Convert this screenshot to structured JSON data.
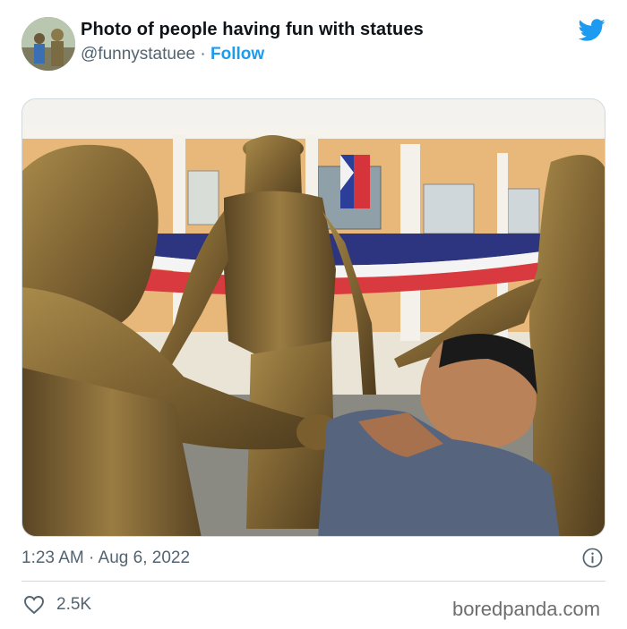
{
  "tweet": {
    "display_name": "Photo of people having fun with statues",
    "handle": "@funnystatuee",
    "separator": " · ",
    "follow_label": "Follow",
    "timestamp": "1:23 AM · Aug 6, 2022",
    "like_count": "2.5K"
  },
  "icons": {
    "brand": "twitter-bird-icon",
    "info": "info-icon",
    "like": "heart-icon"
  },
  "watermark": "boredpanda.com",
  "colors": {
    "accent": "#1d9bf0",
    "text": "#0f1419",
    "secondary_text": "#536471",
    "divider": "#cfd9de"
  }
}
